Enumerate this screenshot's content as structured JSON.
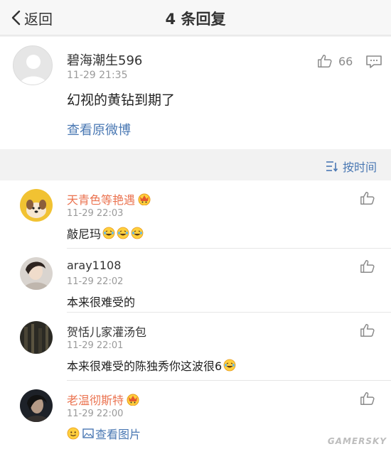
{
  "header": {
    "back_label": "返回",
    "title": "4 条回复"
  },
  "main_post": {
    "author": "碧海潮生596",
    "timestamp": "11-29 21:35",
    "content": "幻视的黄钻到期了",
    "like_count": "66",
    "view_original": "查看原微博"
  },
  "sort": {
    "label": "按时间"
  },
  "comments": [
    {
      "name": "天青色等艳遇",
      "vip": true,
      "time": "11-29 22:03",
      "text": "敲尼玛",
      "laugh_count": 3
    },
    {
      "name": "aray1108",
      "vip": false,
      "time": "11-29 22:02",
      "text": "本来很难受的",
      "laugh_count": 0
    },
    {
      "name": "贺恬儿家灌汤包",
      "vip": false,
      "time": "11-29 22:01",
      "text": "本来很难受的陈独秀你这波很6",
      "laugh_count": 1
    },
    {
      "name": "老温彻斯特",
      "vip": true,
      "time": "11-29 22:00",
      "text": "查看图片",
      "laugh_count": 0
    }
  ],
  "watermark": "GAMERSKY",
  "colors": {
    "link_blue": "#4a78b3",
    "vip_orange": "#eb7350",
    "meta_gray": "#9a9a9a",
    "background": "#f2f2f2"
  },
  "icons": [
    "back-chevron-icon",
    "thumbs-up-icon",
    "reply-comment-icon",
    "sort-time-icon",
    "crown-icon",
    "laughing-tears-emoji-icon",
    "smile-emoji-icon",
    "image-icon"
  ]
}
